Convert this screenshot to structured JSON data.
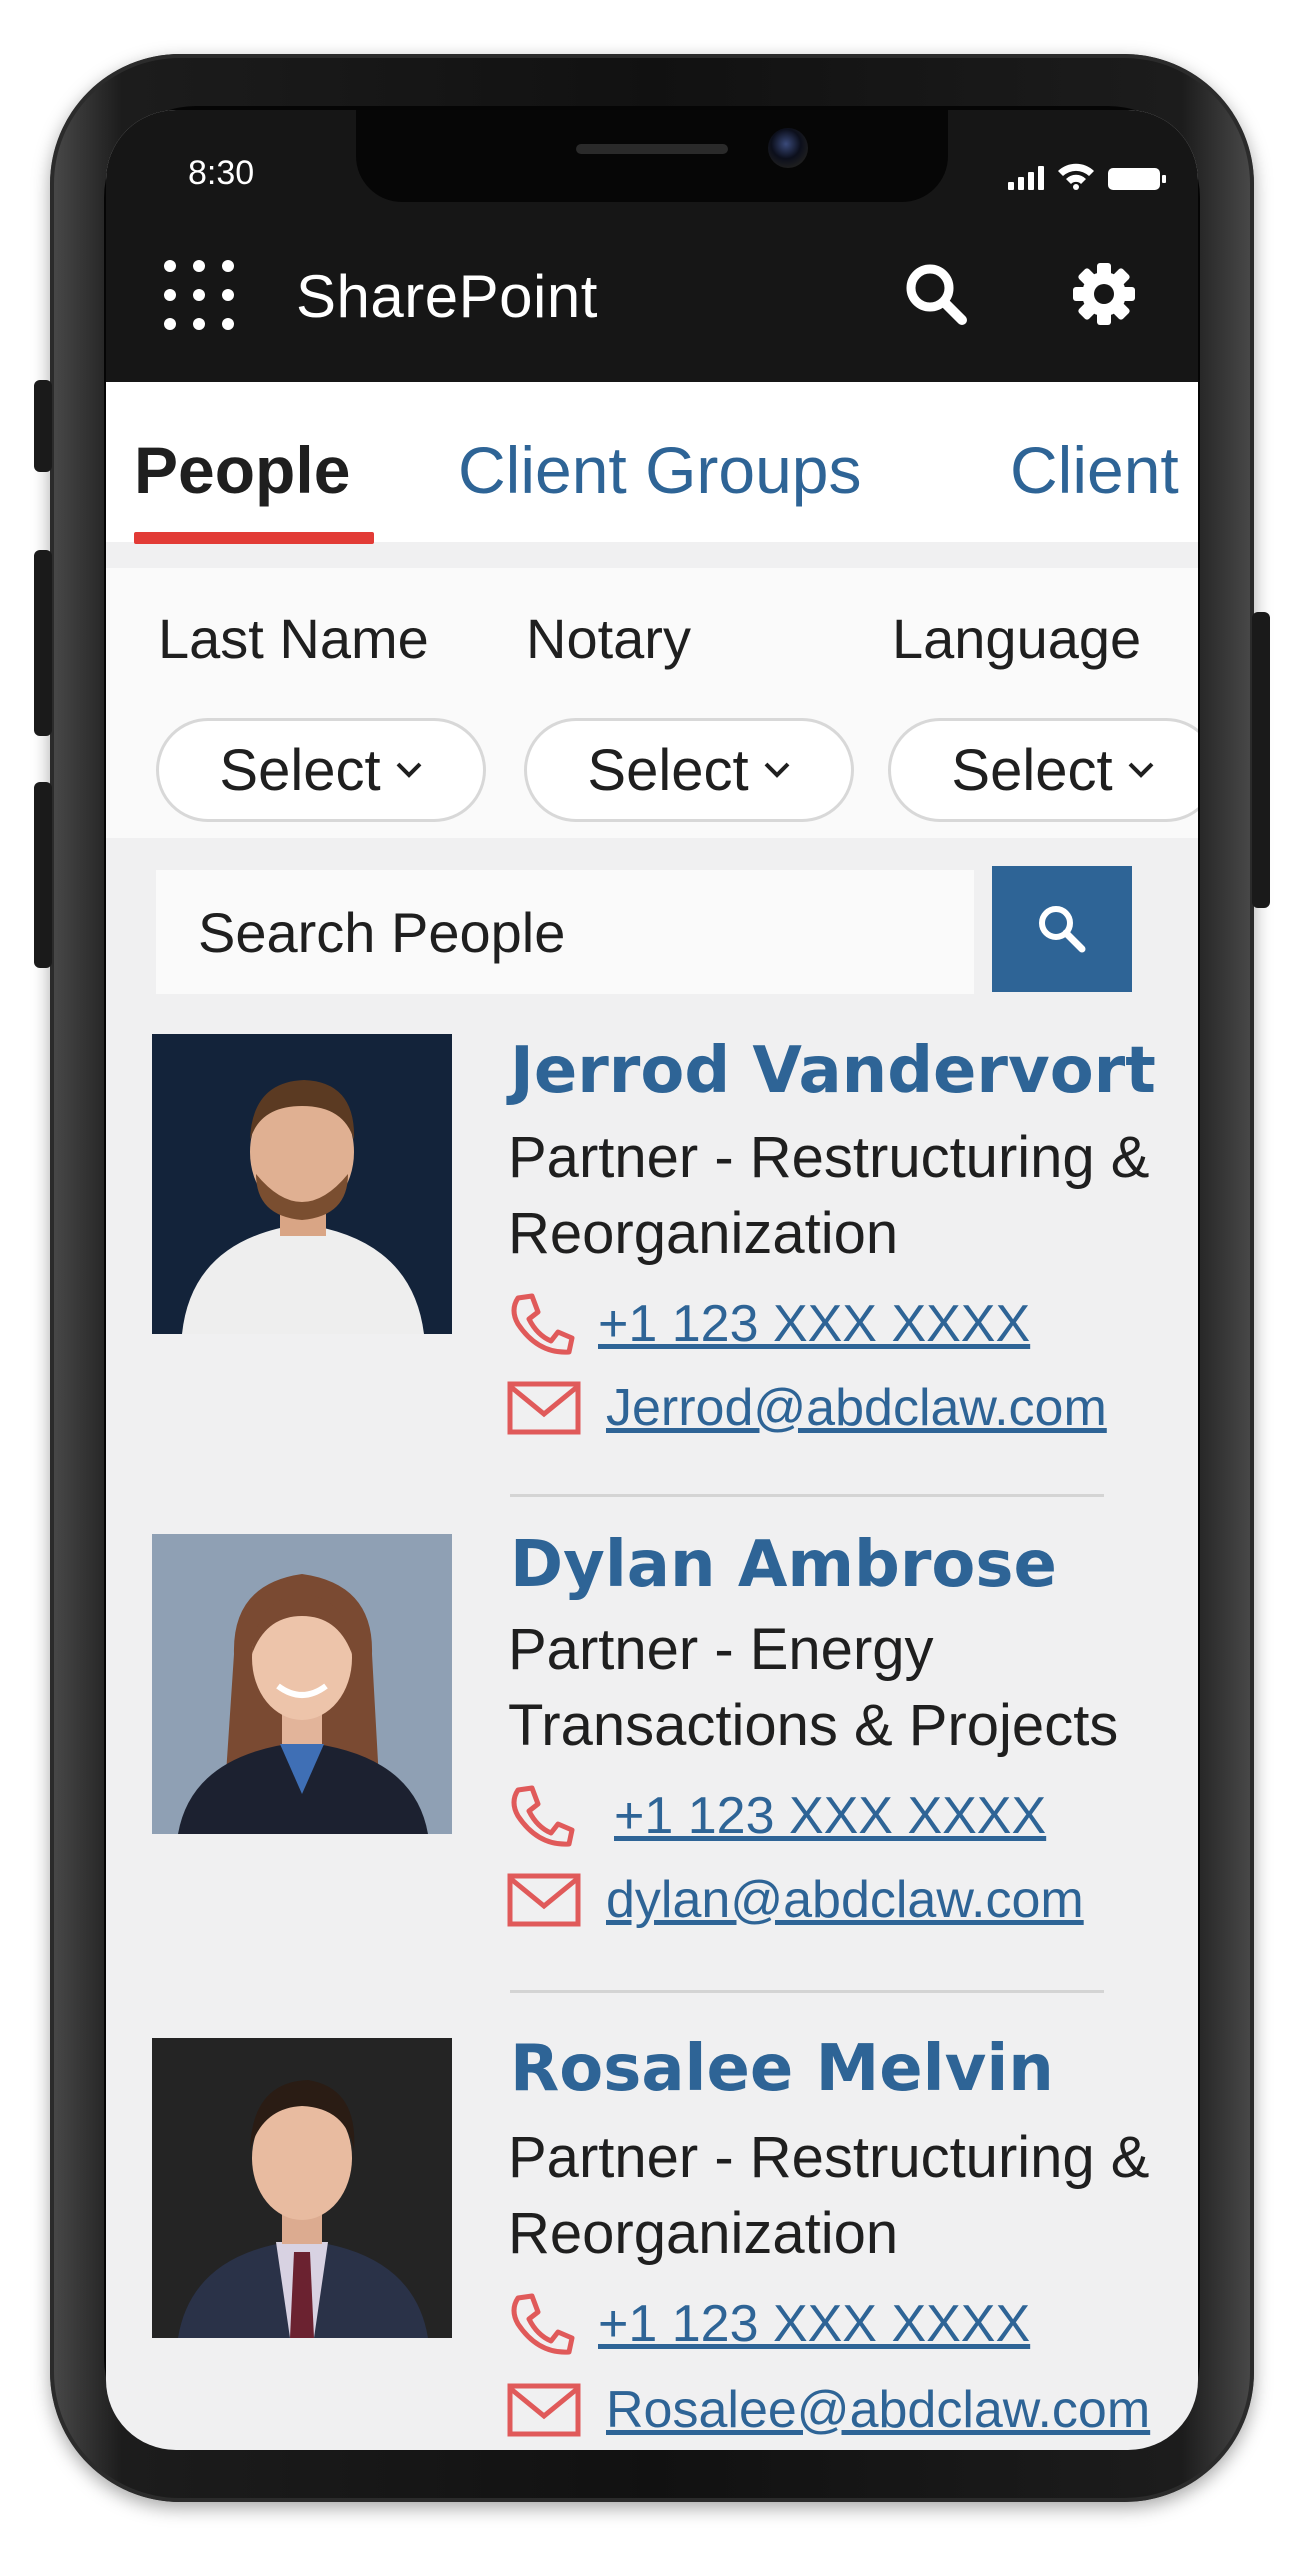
{
  "status_bar": {
    "time": "8:30"
  },
  "app_bar": {
    "title": "SharePoint",
    "icons": [
      "app-launcher-icon",
      "search-icon",
      "gear-icon"
    ]
  },
  "tabs": [
    {
      "label": "People",
      "active": true
    },
    {
      "label": "Client Groups",
      "active": false
    },
    {
      "label": "Client",
      "active": false
    }
  ],
  "filters": [
    {
      "label": "Last Name",
      "value": "Select"
    },
    {
      "label": "Notary",
      "value": "Select"
    },
    {
      "label": "Language",
      "value": "Select"
    }
  ],
  "search": {
    "placeholder": "Search People"
  },
  "people": [
    {
      "name": "Jerrod Vandervort",
      "title": "Partner - Restructuring & Reorganization",
      "phone": "+1 123 XXX XXXX",
      "email": "Jerrod@abdclaw.com"
    },
    {
      "name": "Dylan Ambrose",
      "title": "Partner - Energy Transactions & Projects",
      "phone": "+1 123 XXX XXXX",
      "email": "dylan@abdclaw.com"
    },
    {
      "name": "Rosalee Melvin",
      "title": "Partner - Restructuring & Reorganization",
      "phone": "+1 123 XXX XXXX",
      "email": "Rosalee@abdclaw.com"
    }
  ],
  "colors": {
    "accent": "#2e6496",
    "tab_indicator": "#e23b36",
    "contact_icon": "#e05a5a",
    "app_bar": "#161616"
  }
}
